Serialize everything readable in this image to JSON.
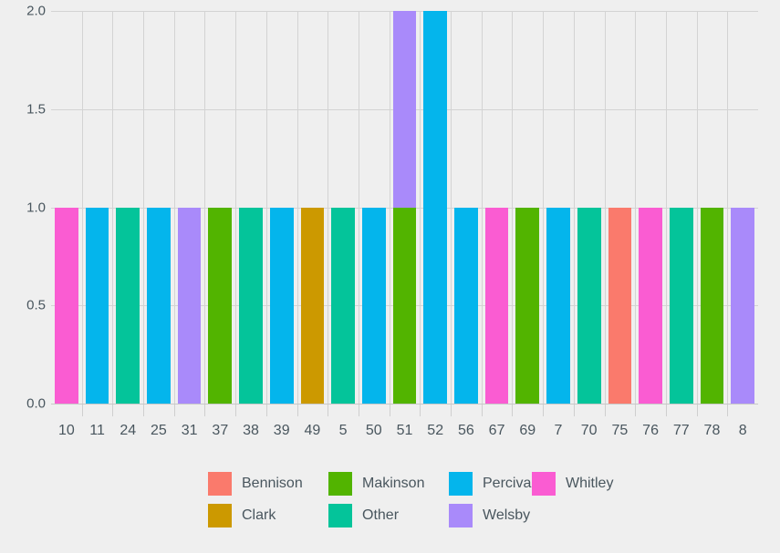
{
  "chart_data": {
    "type": "bar",
    "stacked": true,
    "title": "",
    "xlabel": "",
    "ylabel": "",
    "grid": true,
    "legend_position": "bottom",
    "ylim": [
      0,
      2.0
    ],
    "yticks": [
      "0.0",
      "0.5",
      "1.0",
      "1.5",
      "2.0"
    ],
    "ytick_values": [
      0,
      0.5,
      1.0,
      1.5,
      2.0
    ],
    "categories": [
      "10",
      "11",
      "24",
      "25",
      "31",
      "37",
      "38",
      "39",
      "49",
      "5",
      "50",
      "51",
      "52",
      "56",
      "67",
      "69",
      "7",
      "70",
      "75",
      "76",
      "77",
      "78",
      "8"
    ],
    "series": [
      {
        "name": "Bennison",
        "color": "#fa7a6c",
        "values": [
          0,
          0,
          0,
          0,
          0,
          0,
          0,
          0,
          0,
          0,
          0,
          0,
          0,
          0,
          0,
          0,
          0,
          0,
          1,
          0,
          0,
          0,
          0
        ]
      },
      {
        "name": "Clark",
        "color": "#cc9900",
        "values": [
          0,
          0,
          0,
          0,
          0,
          0,
          0,
          0,
          1,
          0,
          0,
          0,
          0,
          0,
          0,
          0,
          0,
          0,
          0,
          0,
          0,
          0,
          0
        ]
      },
      {
        "name": "Makinson",
        "color": "#52b400",
        "values": [
          0,
          0,
          0,
          0,
          0,
          1,
          0,
          0,
          0,
          0,
          0,
          1,
          0,
          0,
          0,
          1,
          0,
          0,
          0,
          0,
          0,
          1,
          0
        ]
      },
      {
        "name": "Other",
        "color": "#04c49a",
        "values": [
          0,
          0,
          1,
          0,
          0,
          0,
          1,
          0,
          0,
          1,
          0,
          0,
          0,
          0,
          0,
          0,
          0,
          1,
          0,
          0,
          1,
          0,
          0
        ]
      },
      {
        "name": "Percival",
        "color": "#04b5ec",
        "values": [
          0,
          1,
          0,
          1,
          0,
          0,
          0,
          1,
          0,
          0,
          1,
          0,
          2,
          1,
          0,
          0,
          1,
          0,
          0,
          0,
          0,
          0,
          0
        ]
      },
      {
        "name": "Welsby",
        "color": "#a98afa",
        "values": [
          0,
          0,
          0,
          0,
          1,
          0,
          0,
          0,
          0,
          0,
          0,
          1,
          0,
          0,
          0,
          0,
          0,
          0,
          0,
          0,
          0,
          0,
          1
        ]
      },
      {
        "name": "Whitley",
        "color": "#fa5cd2",
        "values": [
          1,
          0,
          0,
          0,
          0,
          0,
          0,
          0,
          0,
          0,
          0,
          0,
          0,
          0,
          1,
          0,
          0,
          0,
          0,
          1,
          0,
          0,
          0
        ]
      }
    ],
    "bar_totals": [
      1,
      1,
      1,
      1,
      1,
      1,
      1,
      1,
      1,
      1,
      1,
      2,
      2,
      1,
      1,
      1,
      1,
      1,
      1,
      1,
      1,
      1,
      1
    ]
  },
  "legend": {
    "entries": [
      {
        "label": "Bennison",
        "color": "#fa7a6c",
        "col": 0,
        "row": 0
      },
      {
        "label": "Clark",
        "color": "#cc9900",
        "col": 0,
        "row": 1
      },
      {
        "label": "Makinson",
        "color": "#52b400",
        "col": 1,
        "row": 0
      },
      {
        "label": "Other",
        "color": "#04c49a",
        "col": 1,
        "row": 1
      },
      {
        "label": "Percival",
        "color": "#04b5ec",
        "col": 2,
        "row": 0
      },
      {
        "label": "Welsby",
        "color": "#a98afa",
        "col": 2,
        "row": 1
      },
      {
        "label": "Whitley",
        "color": "#fa5cd2",
        "col": 3,
        "row": 0
      }
    ]
  },
  "style": {
    "background": "#efefef",
    "grid_color": "#d3d3d3",
    "axis_color": "#c8c8c8",
    "tick_color": "#cfcfcf",
    "text_color": "#49565e"
  }
}
